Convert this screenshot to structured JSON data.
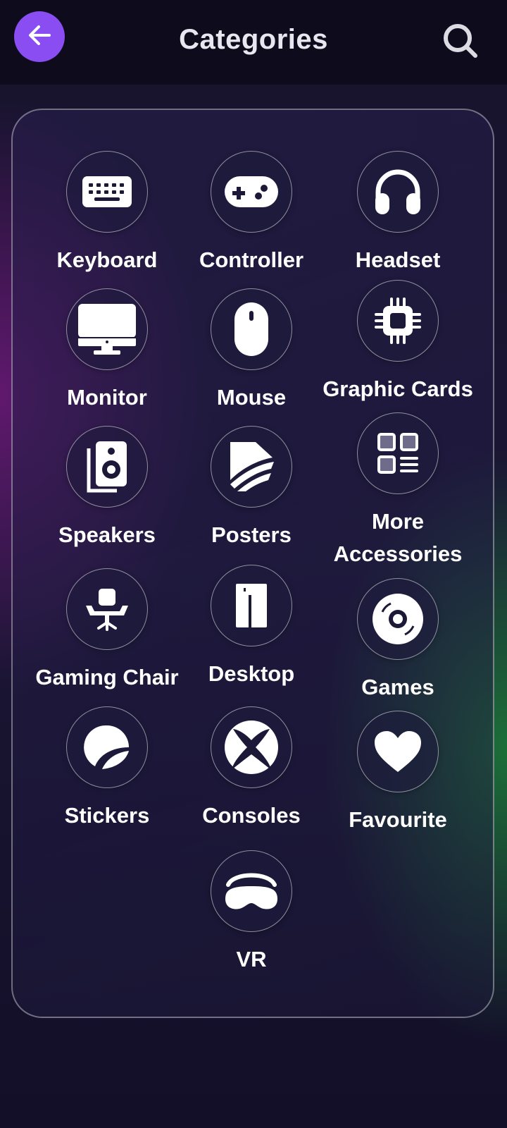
{
  "header": {
    "title": "Categories",
    "back_icon": "arrow-left-icon",
    "search_icon": "search-icon",
    "accent": "#8a4df2"
  },
  "categories": [
    {
      "label": "Keyboard",
      "icon": "keyboard-icon"
    },
    {
      "label": "Controller",
      "icon": "gamepad-icon"
    },
    {
      "label": "Headset",
      "icon": "headphones-icon"
    },
    {
      "label": "Monitor",
      "icon": "monitor-icon"
    },
    {
      "label": "Mouse",
      "icon": "mouse-icon"
    },
    {
      "label": "Graphic Cards",
      "icon": "chip-icon"
    },
    {
      "label": "Speakers",
      "icon": "speaker-icon"
    },
    {
      "label": "Posters",
      "icon": "posters-icon"
    },
    {
      "label": "More Accessories",
      "icon": "grid-icon"
    },
    {
      "label": "Gaming Chair",
      "icon": "chair-icon"
    },
    {
      "label": "Desktop",
      "icon": "desktop-tower-icon"
    },
    {
      "label": "Games",
      "icon": "disc-icon"
    },
    {
      "label": "Stickers",
      "icon": "sticker-icon"
    },
    {
      "label": "Consoles",
      "icon": "xbox-icon"
    },
    {
      "label": "Favourite",
      "icon": "heart-icon"
    },
    {
      "label": "VR",
      "icon": "vr-headset-icon"
    }
  ]
}
